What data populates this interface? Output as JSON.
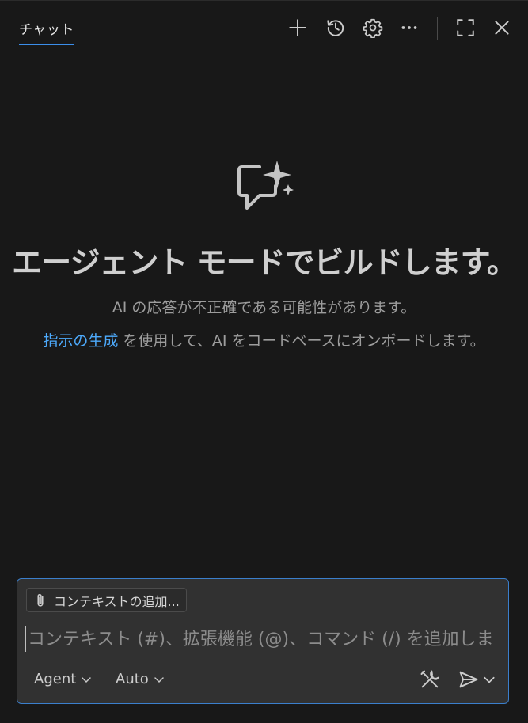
{
  "header": {
    "tab_label": "チャット",
    "toolbar": {
      "new_chat": "plus-icon",
      "history": "history-icon",
      "settings": "gear-icon",
      "more": "ellipsis-icon",
      "maximize": "maximize-icon",
      "close": "close-icon"
    }
  },
  "welcome": {
    "title": "エージェント モードでビルドします。",
    "subtitle": "AI の応答が不正確である可能性があります。",
    "line2_link": "指示の生成",
    "line2_rest": " を使用して、AI をコードベースにオンボードします。"
  },
  "input": {
    "context_chip_label": "コンテキストの追加...",
    "placeholder": "コンテキスト (#)、拡張機能 (@)、コマンド (/) を追加しま",
    "mode_label": "Agent",
    "model_label": "Auto"
  },
  "colors": {
    "background": "#181818",
    "input_background": "#313131",
    "accent": "#3b8eea",
    "link": "#4daafc"
  }
}
